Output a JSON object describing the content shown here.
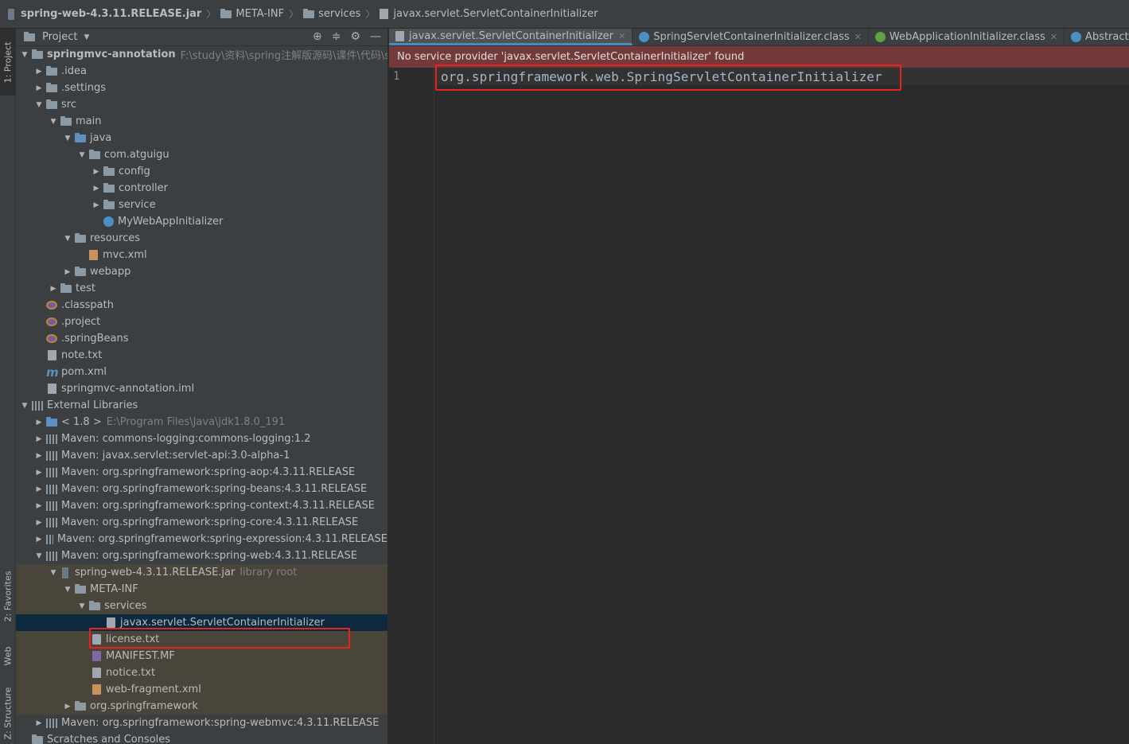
{
  "breadcrumb": {
    "jar": "spring-web-4.3.11.RELEASE.jar",
    "meta": "META-INF",
    "services": "services",
    "file": "javax.servlet.ServletContainerInitializer"
  },
  "toolstrip": {
    "project": "1: Project",
    "favorites": "2: Favorites",
    "web": "Web",
    "structure": "Z: Structure"
  },
  "project_panel": {
    "title": "Project",
    "tree": {
      "root": {
        "name": "springmvc-annotation",
        "path": "F:\\study\\资料\\spring注解版源码\\课件\\代码\\springm"
      },
      "idea": ".idea",
      "settings": ".settings",
      "src": "src",
      "main": "main",
      "java": "java",
      "pkg": "com.atguigu",
      "config": "config",
      "controller": "controller",
      "service": "service",
      "initializer": "MyWebAppInitializer",
      "resources": "resources",
      "mvcxml": "mvc.xml",
      "webapp": "webapp",
      "test": "test",
      "classpath": ".classpath",
      "project": ".project",
      "springbeans": ".springBeans",
      "note": "note.txt",
      "pom": "pom.xml",
      "iml": "springmvc-annotation.iml",
      "external": "External Libraries",
      "jdk": "< 1.8 >",
      "jdk_path": "E:\\Program Files\\Java\\jdk1.8.0_191",
      "libs": [
        "Maven: commons-logging:commons-logging:1.2",
        "Maven: javax.servlet:servlet-api:3.0-alpha-1",
        "Maven: org.springframework:spring-aop:4.3.11.RELEASE",
        "Maven: org.springframework:spring-beans:4.3.11.RELEASE",
        "Maven: org.springframework:spring-context:4.3.11.RELEASE",
        "Maven: org.springframework:spring-core:4.3.11.RELEASE",
        "Maven: org.springframework:spring-expression:4.3.11.RELEASE",
        "Maven: org.springframework:spring-web:4.3.11.RELEASE"
      ],
      "webjar": "spring-web-4.3.11.RELEASE.jar",
      "library_root": "library root",
      "metainf": "META-INF",
      "services": "services",
      "sci_file": "javax.servlet.ServletContainerInitializer",
      "license": "license.txt",
      "manifest": "MANIFEST.MF",
      "notice": "notice.txt",
      "webfragment": "web-fragment.xml",
      "orgspring": "org.springframework",
      "webmvc": "Maven: org.springframework:spring-webmvc:4.3.11.RELEASE",
      "scratches": "Scratches and Consoles"
    }
  },
  "editor": {
    "tabs": [
      {
        "label": "javax.servlet.ServletContainerInitializer"
      },
      {
        "label": "SpringServletContainerInitializer.class"
      },
      {
        "label": "WebApplicationInitializer.class"
      },
      {
        "label": "AbstractContextLoaderIn"
      }
    ],
    "warning": "No service provider 'javax.servlet.ServletContainerInitializer' found",
    "line_number": "1",
    "code": "org.springframework.web.SpringServletContainerInitializer"
  },
  "colors": {
    "highlight": "#e8231f",
    "warning_bg": "#743a3a",
    "selection": "#0d293e"
  }
}
